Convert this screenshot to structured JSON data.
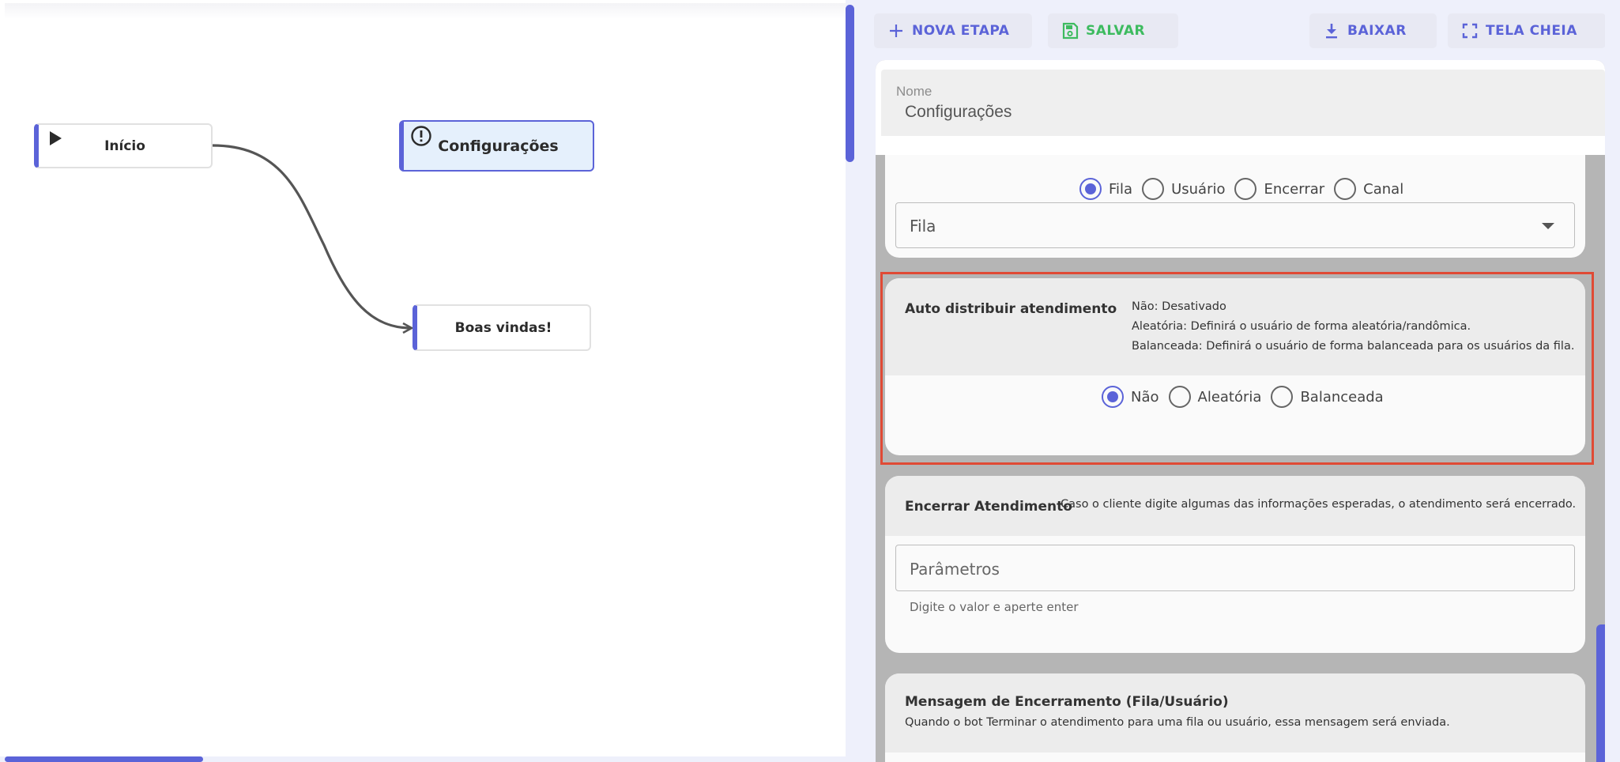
{
  "canvas": {
    "nodes": {
      "start": {
        "label": "Início"
      },
      "config": {
        "label": "Configurações"
      },
      "welcome": {
        "label": "Boas vindas!"
      }
    }
  },
  "toolbar": {
    "new_step": "NOVA ETAPA",
    "save": "SALVAR",
    "download": "BAIXAR",
    "fullscreen": "TELA CHEIA"
  },
  "form": {
    "name_label": "Nome",
    "name_value": "Configurações",
    "destination": {
      "options": [
        "Fila",
        "Usuário",
        "Encerrar",
        "Canal"
      ],
      "selected": "Fila",
      "select_value": "Fila"
    },
    "auto_distribute": {
      "title": "Auto distribuir atendimento",
      "desc_lines": [
        "Não: Desativado",
        "Aleatória: Definirá o usuário de forma aleatória/randômica.",
        "Balanceada: Definirá o usuário de forma balanceada para os usuários da fila."
      ],
      "options": [
        "Não",
        "Aleatória",
        "Balanceada"
      ],
      "selected": "Não"
    },
    "end_service": {
      "title": "Encerrar Atendimento",
      "desc": "Caso o cliente digite algumas das informações esperadas, o atendimento será encerrado.",
      "input_placeholder": "Parâmetros",
      "helper": "Digite o valor e aperte enter"
    },
    "end_message": {
      "title": "Mensagem de Encerramento (Fila/Usuário)",
      "desc": "Quando o bot Terminar o atendimento para uma fila ou usuário, essa mensagem será enviada."
    }
  },
  "colors": {
    "accent": "#5b63d8",
    "save_green": "#3dbb5f",
    "highlight_red": "#e04a35",
    "selected_node_bg": "#e5f0fc"
  }
}
